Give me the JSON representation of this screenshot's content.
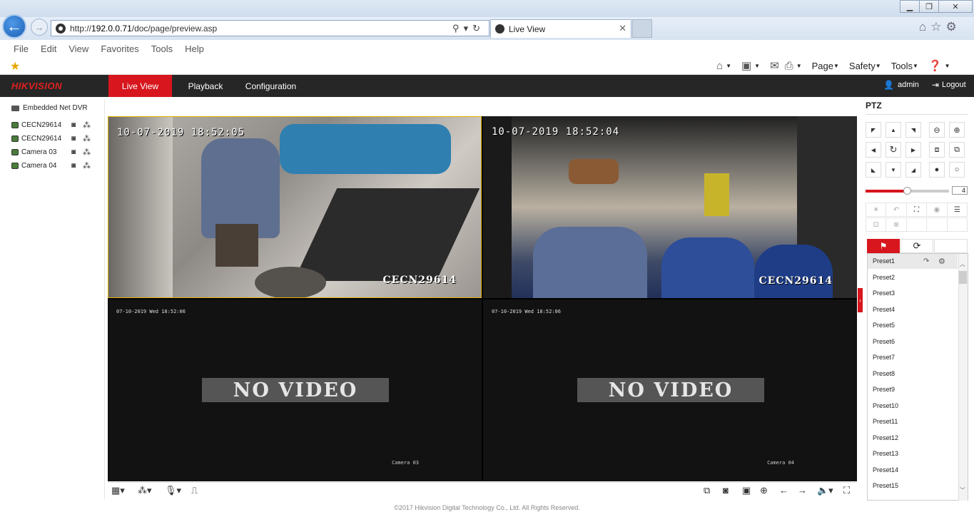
{
  "browser": {
    "url_prefix": "http://",
    "url_host": "192.0.0.71",
    "url_path": "/doc/page/preview.asp",
    "tab_title": "Live View",
    "menu": [
      "File",
      "Edit",
      "View",
      "Favorites",
      "Tools",
      "Help"
    ],
    "cmd_page": "Page",
    "cmd_safety": "Safety",
    "cmd_tools": "Tools"
  },
  "app": {
    "logo": "HIKVISION",
    "nav": [
      "Live View",
      "Playback",
      "Configuration"
    ],
    "active_nav": "Live View",
    "user": "admin",
    "logout": "Logout",
    "accent_color": "#d7161d"
  },
  "sidebar": {
    "device": "Embedded Net DVR",
    "cameras": [
      "CECN29614",
      "CECN29614",
      "Camera 03",
      "Camera 04"
    ]
  },
  "video": {
    "panes": [
      {
        "timestamp": "10-07-2019 18:52:05",
        "osd_name": "CECN29614",
        "state": "live"
      },
      {
        "timestamp": "10-07-2019 18:52:04",
        "osd_name": "CECN29614",
        "state": "live"
      },
      {
        "timestamp": "07-10-2019 Wed 18:52:06",
        "osd_name": "Camera 03",
        "message": "NO VIDEO"
      },
      {
        "timestamp": "07-10-2019 Wed 18:52:06",
        "osd_name": "Camera 04",
        "message": "NO VIDEO"
      }
    ]
  },
  "ptz": {
    "title": "PTZ",
    "speed": "4",
    "speed_fraction": 0.5,
    "presets": [
      "Preset1",
      "Preset2",
      "Preset3",
      "Preset4",
      "Preset5",
      "Preset6",
      "Preset7",
      "Preset8",
      "Preset9",
      "Preset10",
      "Preset11",
      "Preset12",
      "Preset13",
      "Preset14",
      "Preset15"
    ]
  },
  "footer": {
    "copyright": "©2017 Hikvision Digital Technology Co., Ltd. All Rights Reserved."
  }
}
